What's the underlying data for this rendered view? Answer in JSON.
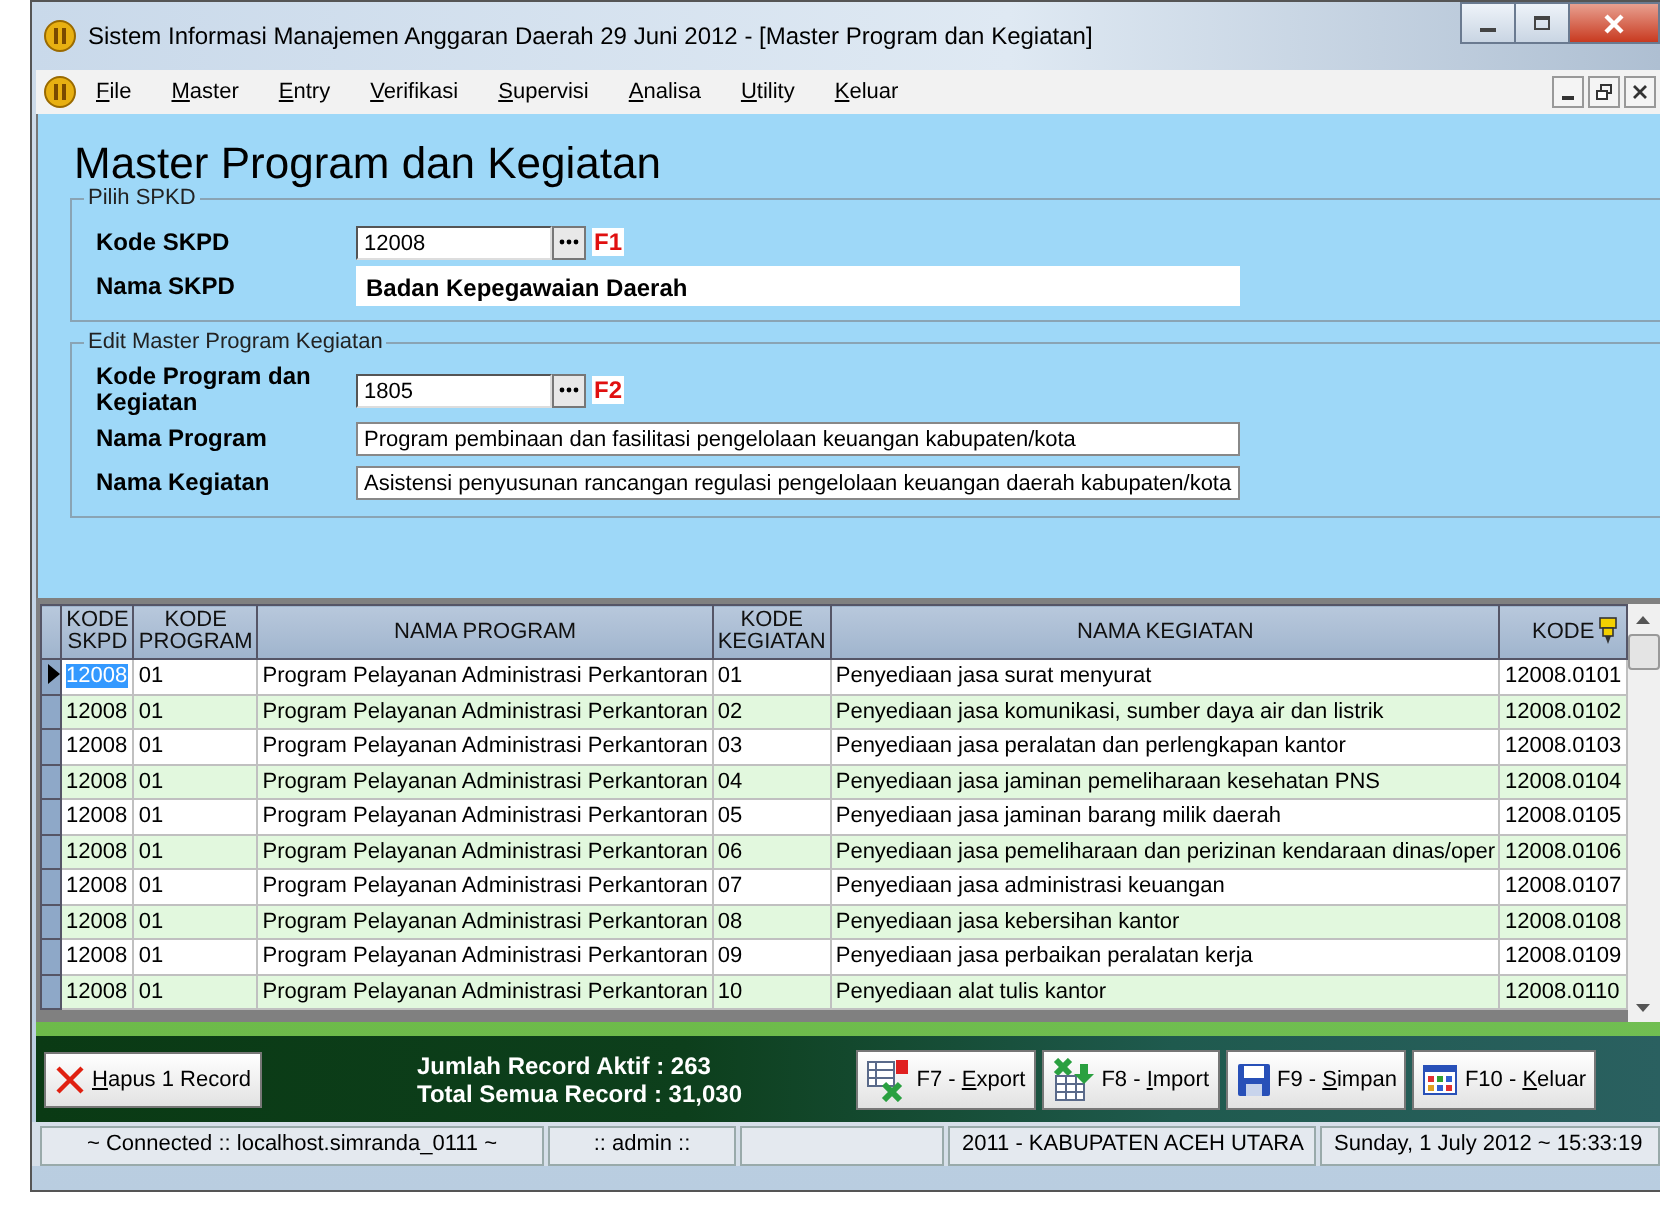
{
  "window": {
    "title": "Sistem Informasi Manajemen Anggaran Daerah 29 Juni 2012 - [Master Program dan Kegiatan]"
  },
  "menu": [
    {
      "label": "File"
    },
    {
      "label": "Master"
    },
    {
      "label": "Entry"
    },
    {
      "label": "Verifikasi"
    },
    {
      "label": "Supervisi"
    },
    {
      "label": "Analisa"
    },
    {
      "label": "Utility"
    },
    {
      "label": "Keluar"
    }
  ],
  "heading": "Master Program dan Kegiatan",
  "groups": [
    {
      "legend": "Pilih SPKD",
      "fields": [
        {
          "label": "Kode SKPD",
          "kind": "lookup",
          "value": "12008",
          "key": "F1"
        },
        {
          "label": "Nama SKPD",
          "kind": "display",
          "value": "Badan Kepegawaian Daerah"
        }
      ]
    },
    {
      "legend": "Edit Master Program Kegiatan",
      "fields": [
        {
          "label": "Kode Program dan Kegiatan",
          "kind": "lookup",
          "value": "1805",
          "key": "F2"
        },
        {
          "label": "Nama Program",
          "kind": "text",
          "value": "Program pembinaan dan fasilitasi pengelolaan keuangan kabupaten/kota"
        },
        {
          "label": "Nama Kegiatan",
          "kind": "text",
          "value": "Asistensi penyusunan rancangan regulasi pengelolaan keuangan daerah kabupaten/kota"
        }
      ]
    }
  ],
  "table": {
    "columns": [
      {
        "label": "KODE\nSKPD"
      },
      {
        "label": "KODE\nPROGRAM"
      },
      {
        "label": "NAMA PROGRAM"
      },
      {
        "label": "KODE\nKEGIATAN"
      },
      {
        "label": "NAMA KEGIATAN"
      },
      {
        "label": "KODE"
      }
    ],
    "rows": [
      {
        "selected": true,
        "cells": [
          "12008",
          "01",
          "Program Pelayanan Administrasi Perkantoran",
          "01",
          "Penyediaan jasa surat menyurat",
          "12008.0101"
        ]
      },
      {
        "selected": false,
        "cells": [
          "12008",
          "01",
          "Program Pelayanan Administrasi Perkantoran",
          "02",
          "Penyediaan jasa komunikasi, sumber daya air dan listrik",
          "12008.0102"
        ]
      },
      {
        "selected": false,
        "cells": [
          "12008",
          "01",
          "Program Pelayanan Administrasi Perkantoran",
          "03",
          "Penyediaan jasa peralatan dan perlengkapan kantor",
          "12008.0103"
        ]
      },
      {
        "selected": false,
        "cells": [
          "12008",
          "01",
          "Program Pelayanan Administrasi Perkantoran",
          "04",
          "Penyediaan jasa jaminan pemeliharaan kesehatan PNS",
          "12008.0104"
        ]
      },
      {
        "selected": false,
        "cells": [
          "12008",
          "01",
          "Program Pelayanan Administrasi Perkantoran",
          "05",
          "Penyediaan jasa jaminan barang milik daerah",
          "12008.0105"
        ]
      },
      {
        "selected": false,
        "cells": [
          "12008",
          "01",
          "Program Pelayanan Administrasi Perkantoran",
          "06",
          "Penyediaan jasa pemeliharaan dan perizinan kendaraan dinas/oper",
          "12008.0106"
        ]
      },
      {
        "selected": false,
        "cells": [
          "12008",
          "01",
          "Program Pelayanan Administrasi Perkantoran",
          "07",
          "Penyediaan jasa administrasi keuangan",
          "12008.0107"
        ]
      },
      {
        "selected": false,
        "cells": [
          "12008",
          "01",
          "Program Pelayanan Administrasi Perkantoran",
          "08",
          "Penyediaan jasa kebersihan kantor",
          "12008.0108"
        ]
      },
      {
        "selected": false,
        "cells": [
          "12008",
          "01",
          "Program Pelayanan Administrasi Perkantoran",
          "09",
          "Penyediaan jasa perbaikan peralatan kerja",
          "12008.0109"
        ]
      },
      {
        "selected": false,
        "cells": [
          "12008",
          "01",
          "Program Pelayanan Administrasi Perkantoran",
          "10",
          "Penyediaan alat tulis kantor",
          "12008.0110"
        ]
      }
    ]
  },
  "footer": {
    "delete_button": {
      "label": "Hapus 1 Record"
    },
    "summary": [
      "Jumlah Record Aktif : 263",
      "Total Semua Record : 31,030"
    ],
    "buttons": [
      {
        "kind": "export",
        "label": "F7 - Export"
      },
      {
        "kind": "import",
        "label": "F8 - Import"
      },
      {
        "kind": "save",
        "label": "F9 - Simpan"
      },
      {
        "kind": "exit",
        "label": "F10 - Keluar"
      }
    ]
  },
  "status_bar": [
    {
      "text": "~ Connected :: localhost.simranda_0111 ~"
    },
    {
      "text": ":: admin ::"
    },
    {
      "kind": "blank"
    },
    {
      "text": "2011 - KABUPATEN ACEH UTARA"
    },
    {
      "text": "Sunday, 1 July 2012 ~ 15:33:19"
    }
  ]
}
